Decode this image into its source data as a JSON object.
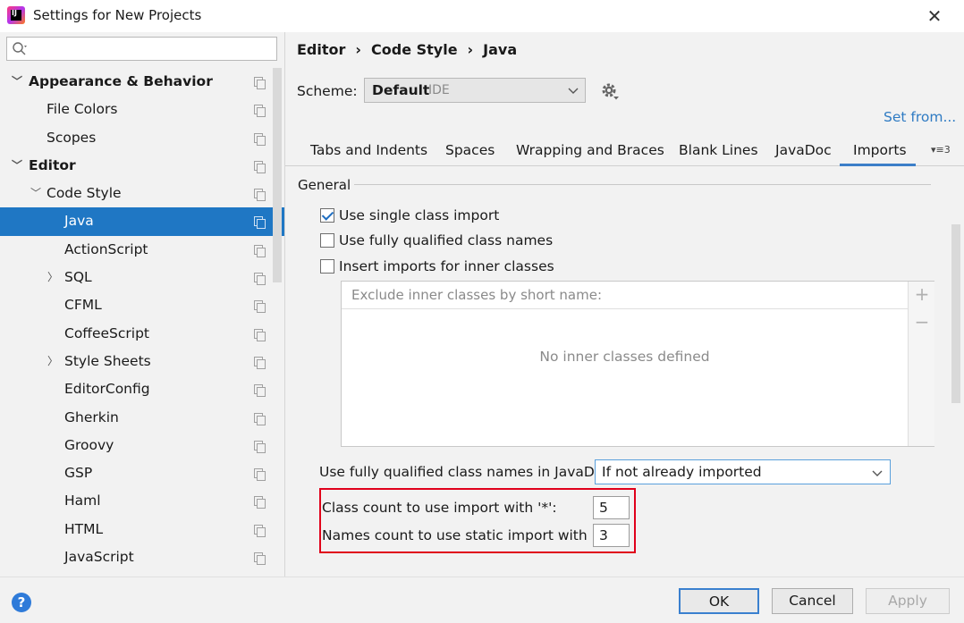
{
  "window": {
    "title": "Settings for New Projects",
    "close_glyph": "✕",
    "app_icon_text": "IJ"
  },
  "search": {
    "value": "",
    "placeholder": ""
  },
  "tree": {
    "items": [
      {
        "label": "Appearance & Behavior",
        "expanded": true
      },
      {
        "label": "File Colors"
      },
      {
        "label": "Scopes"
      },
      {
        "label": "Editor",
        "expanded": true
      },
      {
        "label": "Code Style",
        "expanded": true
      },
      {
        "label": "Java",
        "selected": true
      },
      {
        "label": "ActionScript"
      },
      {
        "label": "SQL",
        "collapsed": true
      },
      {
        "label": "CFML"
      },
      {
        "label": "CoffeeScript"
      },
      {
        "label": "Style Sheets",
        "collapsed": true
      },
      {
        "label": "EditorConfig"
      },
      {
        "label": "Gherkin"
      },
      {
        "label": "Groovy"
      },
      {
        "label": "GSP"
      },
      {
        "label": "Haml"
      },
      {
        "label": "HTML"
      },
      {
        "label": "JavaScript"
      }
    ]
  },
  "breadcrumb": {
    "items": [
      "Editor",
      "Code Style",
      "Java"
    ],
    "separator": "›"
  },
  "scheme": {
    "label": "Scheme:",
    "value": "Default",
    "tag": "IDE"
  },
  "set_from": "Set from...",
  "tabs": {
    "items": [
      "Tabs and Indents",
      "Spaces",
      "Wrapping and Braces",
      "Blank Lines",
      "JavaDoc",
      "Imports"
    ],
    "active": "Imports",
    "more": "▾≡3"
  },
  "general": {
    "title": "General",
    "options": [
      {
        "label": "Use single class import",
        "checked": true
      },
      {
        "label": "Use fully qualified class names",
        "checked": false
      },
      {
        "label": "Insert imports for inner classes",
        "checked": false
      }
    ]
  },
  "inner_classes": {
    "header": "Exclude inner classes by short name:",
    "empty": "No inner classes defined",
    "add": "+",
    "remove": "−"
  },
  "javadoc": {
    "label": "Use fully qualified class names in JavaDoc:",
    "value": "If not already imported"
  },
  "counts": {
    "class_label": "Class count to use import with '*':",
    "class_value": "5",
    "names_label": "Names count to use static import with '*':",
    "names_value": "3",
    "highlight_color": "#e0001b"
  },
  "buttons": {
    "help": "?",
    "ok": "OK",
    "cancel": "Cancel",
    "apply": "Apply"
  },
  "colors": {
    "selection": "#1f77c4",
    "accent": "#3c7fc8",
    "link": "#2f7bc3"
  }
}
